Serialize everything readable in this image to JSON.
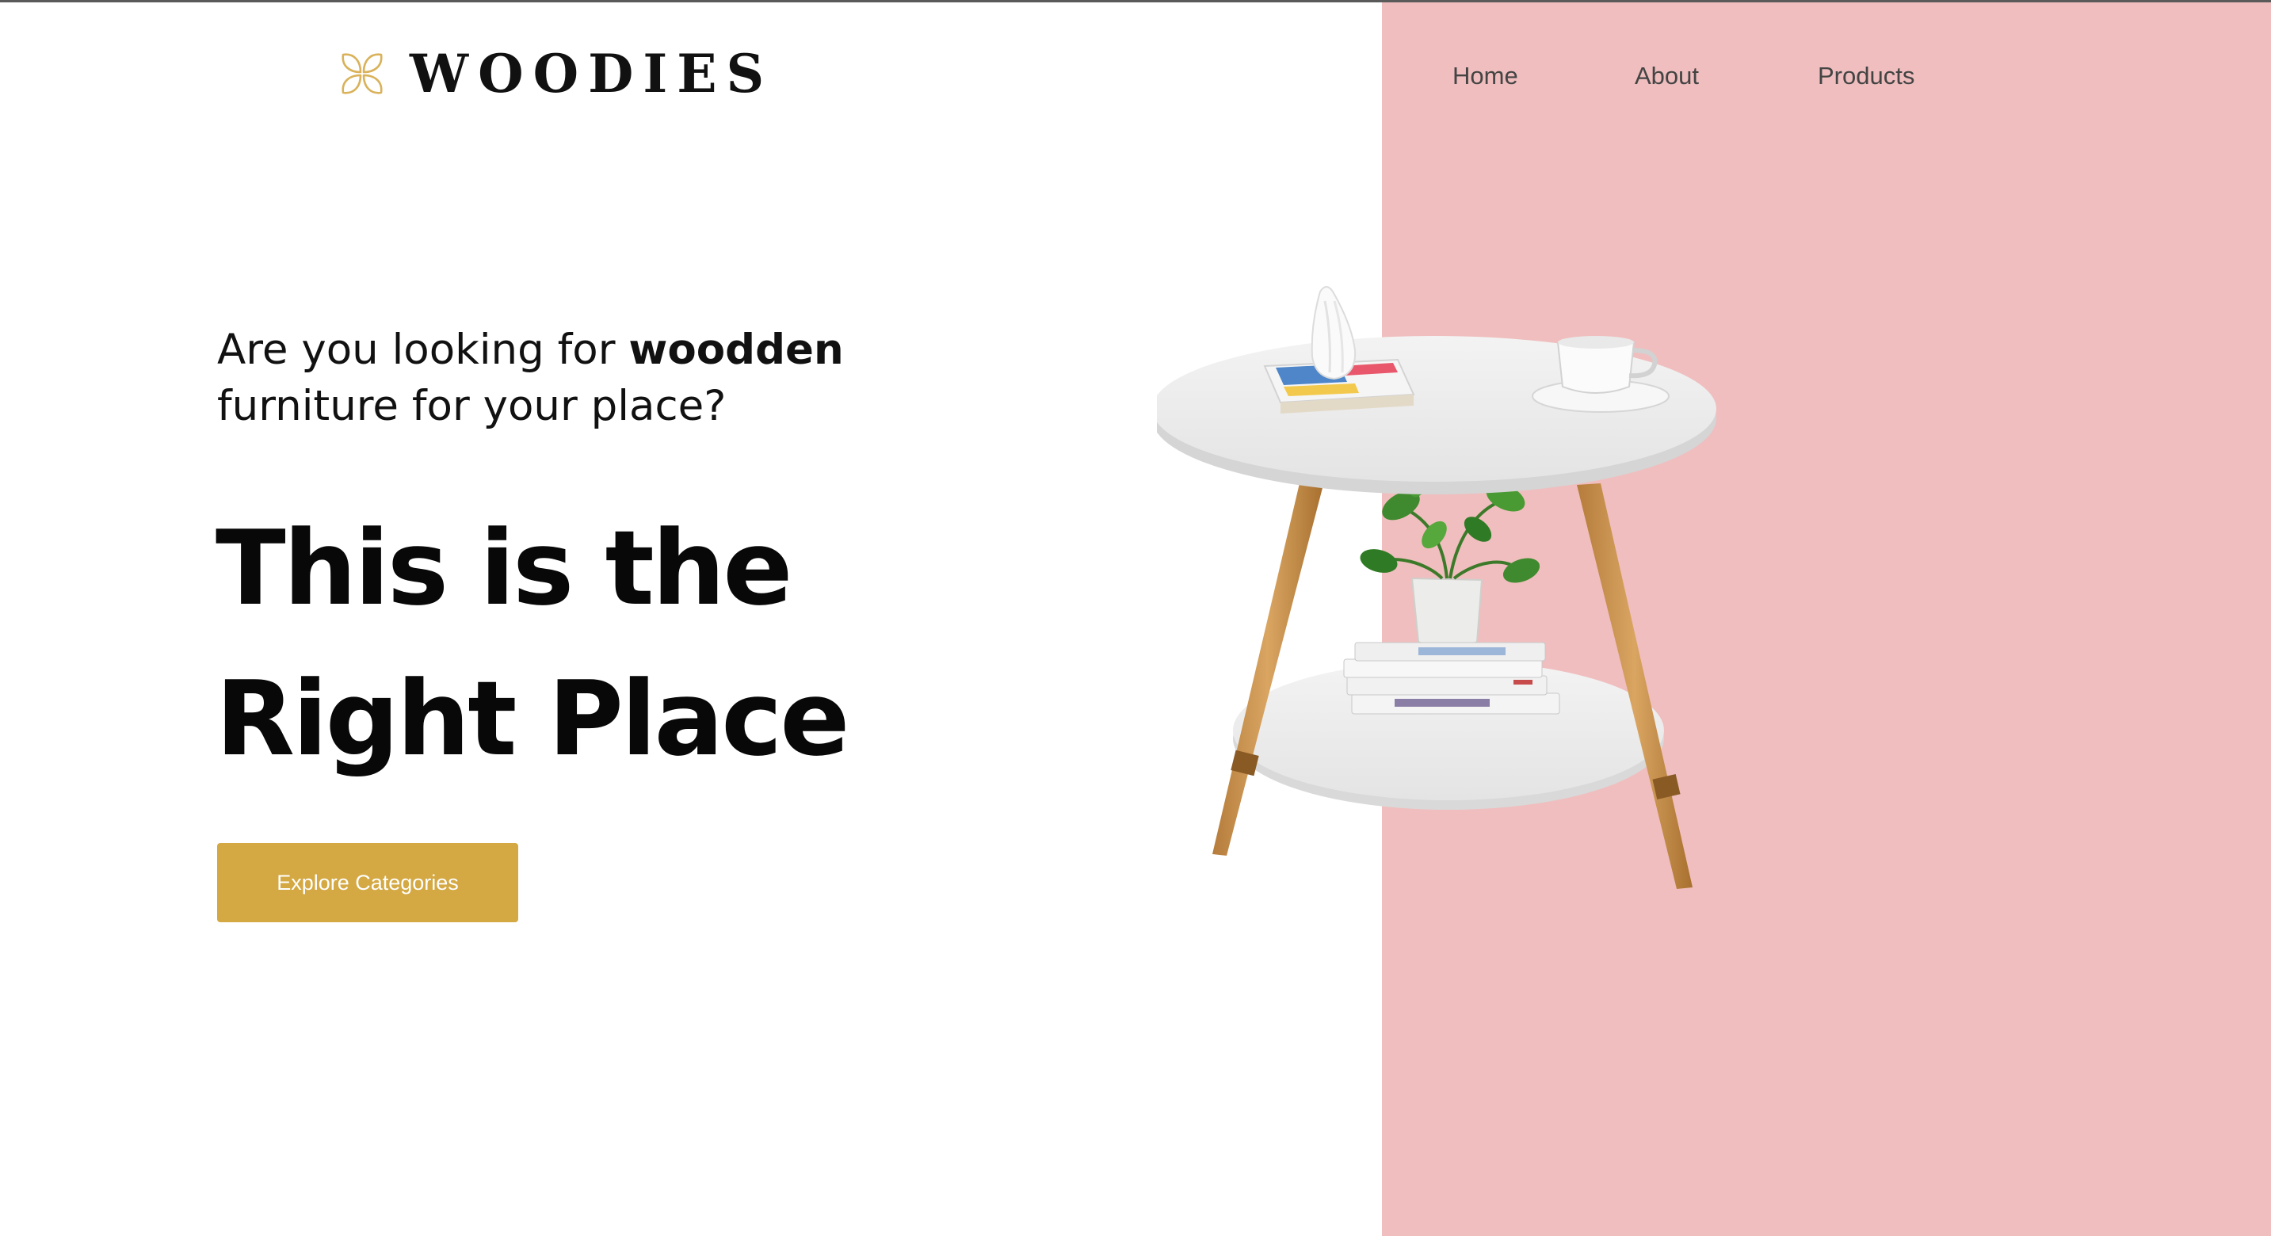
{
  "brand": {
    "name": "WOODIES",
    "icon": "flower-logo-icon",
    "icon_color": "#d9b25a"
  },
  "nav": {
    "items": [
      {
        "label": "Home"
      },
      {
        "label": "About"
      },
      {
        "label": "Products"
      }
    ]
  },
  "hero": {
    "question_prefix": "Are you looking for ",
    "question_strong": "woodden",
    "question_suffix": "furniture for your place?",
    "heading_line1": "This is the",
    "heading_line2": "Right Place",
    "cta_label": "Explore Categories"
  },
  "illustration": {
    "icon": "side-table-illustration"
  },
  "colors": {
    "accent": "#d4a843",
    "panel": "#f0bebe",
    "text": "#111111"
  }
}
